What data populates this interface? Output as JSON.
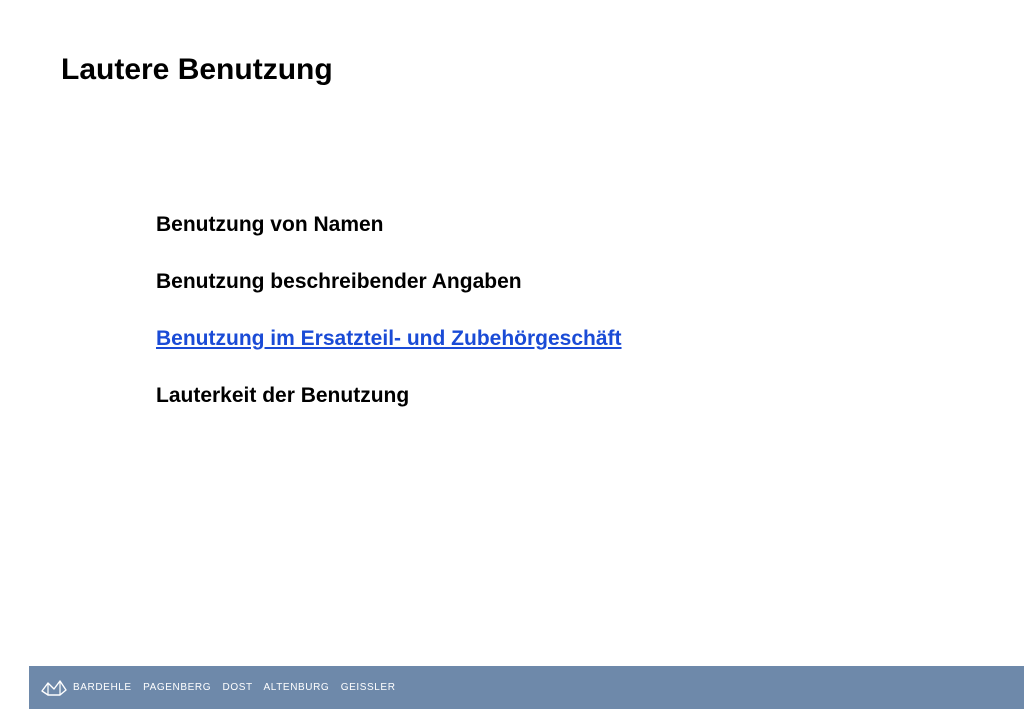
{
  "slide": {
    "title": "Lautere Benutzung"
  },
  "topics": [
    {
      "label": "Benutzung von Namen",
      "is_link": false
    },
    {
      "label": "Benutzung beschreibender Angaben",
      "is_link": false
    },
    {
      "label": "Benutzung im Ersatzteil- und Zubehörgeschäft",
      "is_link": true
    },
    {
      "label": "Lauterkeit der Benutzung",
      "is_link": false
    }
  ],
  "footer": {
    "logo_icon": "firm-logo-icon",
    "firm_names": [
      "BARDEHLE",
      "PAGENBERG",
      "DOST",
      "ALTENBURG",
      "GEISSLER"
    ]
  },
  "colors": {
    "footer_background": "#6e89aa",
    "link": "#1a4bd6",
    "text": "#000000"
  }
}
